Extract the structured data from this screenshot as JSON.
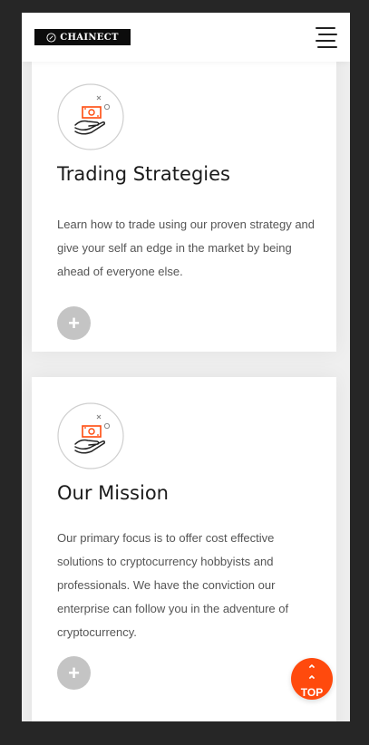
{
  "navbar": {
    "logo_text": "CHAINECT",
    "menu_icon": "hamburger-menu-icon"
  },
  "cards": [
    {
      "icon": "money-hand-icon",
      "title": "Trading Strategies",
      "text": "Learn how to trade using our proven strategy and give your self an edge in the market by being ahead of everyone else.",
      "button_label": "+"
    },
    {
      "icon": "money-hand-icon",
      "title": "Our Mission",
      "text": "Our primary focus is to offer cost effective solutions to cryptocurrency hobbyists and professionals. We have the conviction our enterprise can follow you in the adventure of cryptocurrency.",
      "button_label": "+"
    }
  ],
  "back_to_top": {
    "icon": "double-chevron-up-icon",
    "label": "TOP"
  },
  "colors": {
    "accent": "#ff4a0d",
    "page_background": "#262626",
    "content_background": "#efefef"
  }
}
